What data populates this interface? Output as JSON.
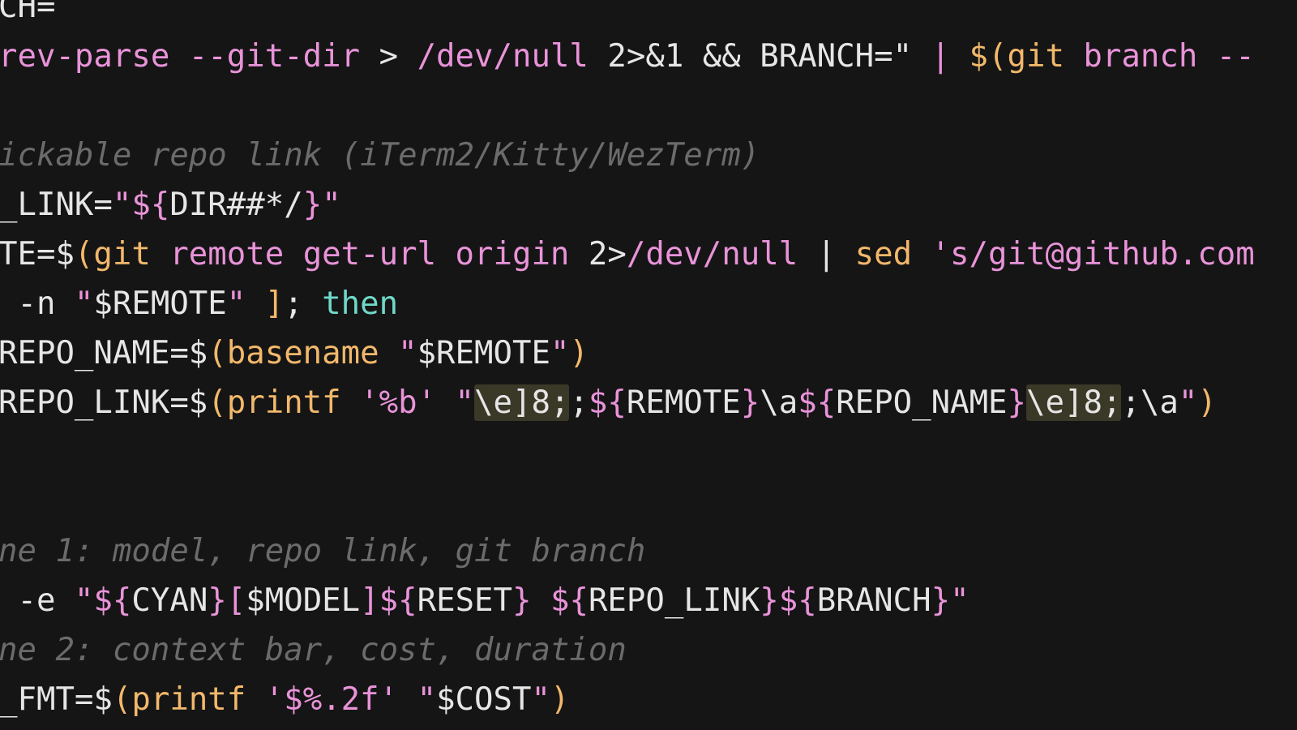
{
  "editor": {
    "theme": {
      "background": "#151515",
      "default_text": "#e6e6e6",
      "string": "#e993d9",
      "function": "#f2b86b",
      "keyword": "#6fd9c9",
      "comment": "#6b6b6b",
      "highlight": "#3a3927"
    },
    "lines": [
      {
        "segments": [
          {
            "text": "CH=",
            "color": "#e6e6e6"
          }
        ]
      },
      {
        "segments": [
          {
            "text": "rev-parse --git-dir ",
            "color": "#e993d9"
          },
          {
            "text": "> ",
            "color": "#e6e6e6"
          },
          {
            "text": "/dev/null ",
            "color": "#e993d9"
          },
          {
            "text": "2>&1 && BRANCH=\"",
            "color": "#e6e6e6"
          },
          {
            "text": " | ",
            "color": "#e993d9"
          },
          {
            "text": "$(",
            "color": "#f2b86b"
          },
          {
            "text": "git ",
            "color": "#f2b86b"
          },
          {
            "text": "branch --",
            "color": "#e993d9"
          }
        ]
      },
      {
        "segments": []
      },
      {
        "comment": true,
        "segments": [
          {
            "text": "ickable repo link (iTerm2/Kitty/WezTerm)",
            "color": "#6b6b6b"
          }
        ]
      },
      {
        "segments": [
          {
            "text": "_LINK=",
            "color": "#e6e6e6"
          },
          {
            "text": "\"${",
            "color": "#e993d9"
          },
          {
            "text": "DIR##*/",
            "color": "#e6e6e6"
          },
          {
            "text": "}\"",
            "color": "#e993d9"
          }
        ]
      },
      {
        "segments": [
          {
            "text": "TE=$",
            "color": "#e6e6e6"
          },
          {
            "text": "(",
            "color": "#f2b86b"
          },
          {
            "text": "git ",
            "color": "#f2b86b"
          },
          {
            "text": "remote get-url origin ",
            "color": "#e993d9"
          },
          {
            "text": "2>",
            "color": "#e6e6e6"
          },
          {
            "text": "/dev/null ",
            "color": "#e993d9"
          },
          {
            "text": "| ",
            "color": "#e6e6e6"
          },
          {
            "text": "sed ",
            "color": "#f2b86b"
          },
          {
            "text": "'s/git@github.com",
            "color": "#e993d9"
          }
        ]
      },
      {
        "segments": [
          {
            "text": " -n ",
            "color": "#e6e6e6"
          },
          {
            "text": "\"",
            "color": "#e993d9"
          },
          {
            "text": "$REMOTE",
            "color": "#e6e6e6"
          },
          {
            "text": "\" ",
            "color": "#e993d9"
          },
          {
            "text": "]",
            "color": "#f2b86b"
          },
          {
            "text": "; ",
            "color": "#e6e6e6"
          },
          {
            "text": "then",
            "color": "#6fd9c9"
          }
        ]
      },
      {
        "segments": [
          {
            "text": "REPO_NAME=$",
            "color": "#e6e6e6"
          },
          {
            "text": "(",
            "color": "#f2b86b"
          },
          {
            "text": "basename ",
            "color": "#f2b86b"
          },
          {
            "text": "\"",
            "color": "#e993d9"
          },
          {
            "text": "$REMOTE",
            "color": "#e6e6e6"
          },
          {
            "text": "\"",
            "color": "#e993d9"
          },
          {
            "text": ")",
            "color": "#f2b86b"
          }
        ]
      },
      {
        "segments": [
          {
            "text": "REPO_LINK=$",
            "color": "#e6e6e6"
          },
          {
            "text": "(",
            "color": "#f2b86b"
          },
          {
            "text": "printf ",
            "color": "#f2b86b"
          },
          {
            "text": "'%b' ",
            "color": "#e993d9"
          },
          {
            "text": "\"",
            "color": "#e993d9"
          },
          {
            "text": "\\e]8;",
            "color": "#e6e6e6",
            "highlight": true
          },
          {
            "text": ";",
            "color": "#e6e6e6"
          },
          {
            "text": "${",
            "color": "#e993d9"
          },
          {
            "text": "REMOTE",
            "color": "#e6e6e6"
          },
          {
            "text": "}",
            "color": "#e993d9"
          },
          {
            "text": "\\a",
            "color": "#e6e6e6"
          },
          {
            "text": "${",
            "color": "#e993d9"
          },
          {
            "text": "REPO_NAME",
            "color": "#e6e6e6"
          },
          {
            "text": "}",
            "color": "#e993d9"
          },
          {
            "text": "\\e]8;",
            "color": "#e6e6e6",
            "highlight": true
          },
          {
            "text": ";\\a",
            "color": "#e6e6e6"
          },
          {
            "text": "\"",
            "color": "#e993d9"
          },
          {
            "text": ")",
            "color": "#f2b86b"
          }
        ]
      },
      {
        "segments": []
      },
      {
        "segments": []
      },
      {
        "comment": true,
        "segments": [
          {
            "text": "ne 1: model, repo link, git branch",
            "color": "#6b6b6b"
          }
        ]
      },
      {
        "segments": [
          {
            "text": " -e ",
            "color": "#e6e6e6"
          },
          {
            "text": "\"${",
            "color": "#e993d9"
          },
          {
            "text": "CYAN",
            "color": "#e6e6e6"
          },
          {
            "text": "}",
            "color": "#e993d9"
          },
          {
            "text": "[",
            "color": "#e993d9"
          },
          {
            "text": "$MODEL",
            "color": "#e6e6e6"
          },
          {
            "text": "]",
            "color": "#e993d9"
          },
          {
            "text": "${",
            "color": "#e993d9"
          },
          {
            "text": "RESET",
            "color": "#e6e6e6"
          },
          {
            "text": "} ",
            "color": "#e993d9"
          },
          {
            "text": "${",
            "color": "#e993d9"
          },
          {
            "text": "REPO_LINK",
            "color": "#e6e6e6"
          },
          {
            "text": "}",
            "color": "#e993d9"
          },
          {
            "text": "${",
            "color": "#e993d9"
          },
          {
            "text": "BRANCH",
            "color": "#e6e6e6"
          },
          {
            "text": "}\"",
            "color": "#e993d9"
          }
        ]
      },
      {
        "comment": true,
        "segments": [
          {
            "text": "ne 2: context bar, cost, duration",
            "color": "#6b6b6b"
          }
        ]
      },
      {
        "segments": [
          {
            "text": "_FMT=$",
            "color": "#e6e6e6"
          },
          {
            "text": "(",
            "color": "#f2b86b"
          },
          {
            "text": "printf ",
            "color": "#f2b86b"
          },
          {
            "text": "'$%.2f' ",
            "color": "#e993d9"
          },
          {
            "text": "\"",
            "color": "#e993d9"
          },
          {
            "text": "$COST",
            "color": "#e6e6e6"
          },
          {
            "text": "\"",
            "color": "#e993d9"
          },
          {
            "text": ")",
            "color": "#f2b86b"
          }
        ]
      }
    ]
  }
}
